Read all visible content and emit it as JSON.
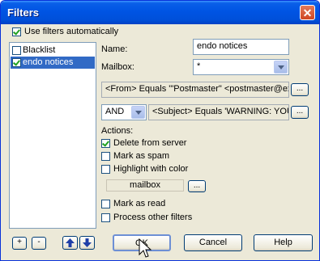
{
  "window": {
    "title": "Filters",
    "close_glyph": "✕"
  },
  "use_filters": {
    "label": "Use filters automatically",
    "checked": true
  },
  "filter_list": [
    {
      "label": "Blacklist",
      "checked": false,
      "selected": false
    },
    {
      "label": "endo notices",
      "checked": true,
      "selected": true
    }
  ],
  "form": {
    "name_label": "Name:",
    "name_value": "endo notices",
    "mailbox_label": "Mailbox:",
    "mailbox_value": "*",
    "condition1": "<From> Equals '\"Postmaster\" <postmaster@exa",
    "operator": "AND",
    "condition2": "<Subject> Equals 'WARNING: YOU",
    "ellipsis": "...",
    "actions_label": "Actions:",
    "actions": [
      {
        "label": "Delete from server",
        "checked": true
      },
      {
        "label": "Mark as spam",
        "checked": false
      },
      {
        "label": "Highlight with color",
        "checked": false
      }
    ],
    "color_label": "mailbox",
    "more_actions": [
      {
        "label": "Mark as read",
        "checked": false
      },
      {
        "label": "Process other filters",
        "checked": false
      }
    ]
  },
  "list_buttons": {
    "add": "+",
    "remove": "-",
    "up_icon": "arrow-up-icon",
    "down_icon": "arrow-down-icon"
  },
  "buttons": {
    "ok": "OK",
    "cancel": "Cancel",
    "help": "Help"
  },
  "colors": {
    "titlebar": "#0054e3",
    "selection": "#316ac5",
    "arrow": "#1f3fa8"
  }
}
